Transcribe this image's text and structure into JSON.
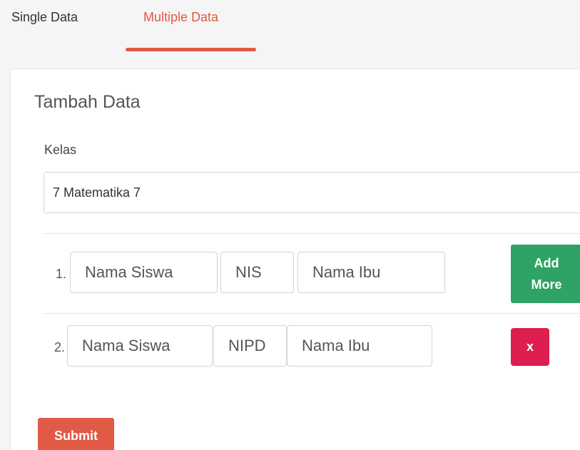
{
  "tabs": {
    "single_label": "Single Data",
    "multiple_label": "Multiple Data",
    "active": "Multiple Data"
  },
  "form": {
    "title": "Tambah Data",
    "kelas_label": "Kelas",
    "kelas_value": "7 Matematika 7",
    "rows": [
      {
        "number": "1.",
        "nama_siswa_placeholder": "Nama Siswa",
        "id_placeholder": "NIS",
        "nama_ibu_placeholder": "Nama Ibu"
      },
      {
        "number": "2.",
        "nama_siswa_placeholder": "Nama Siswa",
        "id_placeholder": "NIPD",
        "nama_ibu_placeholder": "Nama Ibu"
      }
    ],
    "add_more_line1": "Add",
    "add_more_line2": "More",
    "remove_label": "x",
    "submit_label": "Submit"
  },
  "colors": {
    "accent": "#e05a46",
    "add_button": "#2fa365",
    "remove_button": "#dc1f4e"
  }
}
